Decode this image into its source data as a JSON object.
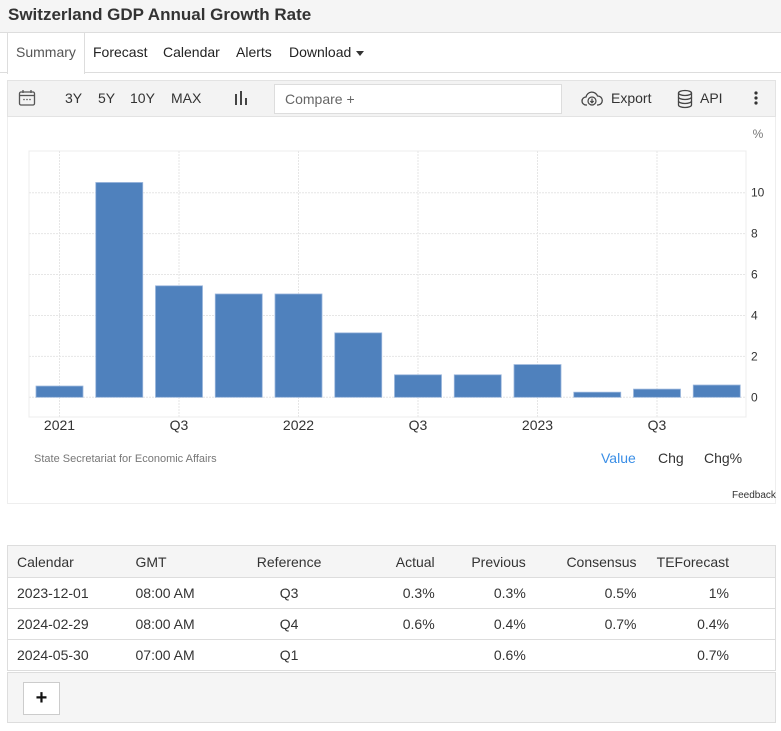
{
  "header": {
    "title": "Switzerland GDP Annual Growth Rate"
  },
  "tabs": [
    {
      "label": "Summary",
      "active": true
    },
    {
      "label": "Forecast"
    },
    {
      "label": "Calendar"
    },
    {
      "label": "Alerts"
    },
    {
      "label": "Download"
    }
  ],
  "toolbar": {
    "calendar_icon": "calendar-icon",
    "ranges": [
      "3Y",
      "5Y",
      "10Y",
      "MAX"
    ],
    "chart_type_icon": "bar-chart-icon",
    "compare_placeholder": "Compare +",
    "export_label": "Export",
    "export_icon": "cloud-download-icon",
    "api_label": "API",
    "api_icon": "database-icon",
    "more_icon": "vertical-dots-icon"
  },
  "chart_data": {
    "type": "bar",
    "title": "Switzerland GDP Annual Growth Rate",
    "ylabel": "%",
    "xlabel": "",
    "categories": [
      "2021 Q1",
      "2021 Q2",
      "2021 Q3",
      "2021 Q4",
      "2022 Q1",
      "2022 Q2",
      "2022 Q3",
      "2022 Q4",
      "2023 Q1",
      "2023 Q2",
      "2023 Q3",
      "2023 Q4"
    ],
    "values": [
      0.55,
      10.5,
      5.45,
      5.05,
      5.05,
      3.15,
      1.1,
      1.1,
      1.6,
      0.25,
      0.4,
      0.6
    ],
    "x_tick_labels": [
      {
        "index": 0,
        "label": "2021"
      },
      {
        "index": 2,
        "label": "Q3"
      },
      {
        "index": 4,
        "label": "2022"
      },
      {
        "index": 6,
        "label": "Q3"
      },
      {
        "index": 8,
        "label": "2023"
      },
      {
        "index": 10,
        "label": "Q3"
      }
    ],
    "y_ticks": [
      0,
      2,
      4,
      6,
      8,
      10
    ],
    "ylim": [
      -1.5,
      12.2
    ],
    "y_axis_side": "right",
    "grid": true,
    "bar_color": "#4f81bd",
    "source": "State Secretariat for Economic Affairs"
  },
  "chart_modes": [
    {
      "label": "Value",
      "active": true,
      "color": "#3a8ee6"
    },
    {
      "label": "Chg"
    },
    {
      "label": "Chg%"
    }
  ],
  "feedback_label": "Feedback",
  "calendar": {
    "headers": [
      "Calendar",
      "GMT",
      "Reference",
      "Actual",
      "Previous",
      "Consensus",
      "TEForecast"
    ],
    "rows": [
      [
        "2023-12-01",
        "08:00 AM",
        "Q3",
        "0.3%",
        "0.3%",
        "0.5%",
        "1%"
      ],
      [
        "2024-02-29",
        "08:00 AM",
        "Q4",
        "0.6%",
        "0.4%",
        "0.7%",
        "0.4%"
      ],
      [
        "2024-05-30",
        "07:00 AM",
        "Q1",
        "",
        "0.6%",
        "",
        "0.7%"
      ]
    ],
    "add_label": "+"
  }
}
